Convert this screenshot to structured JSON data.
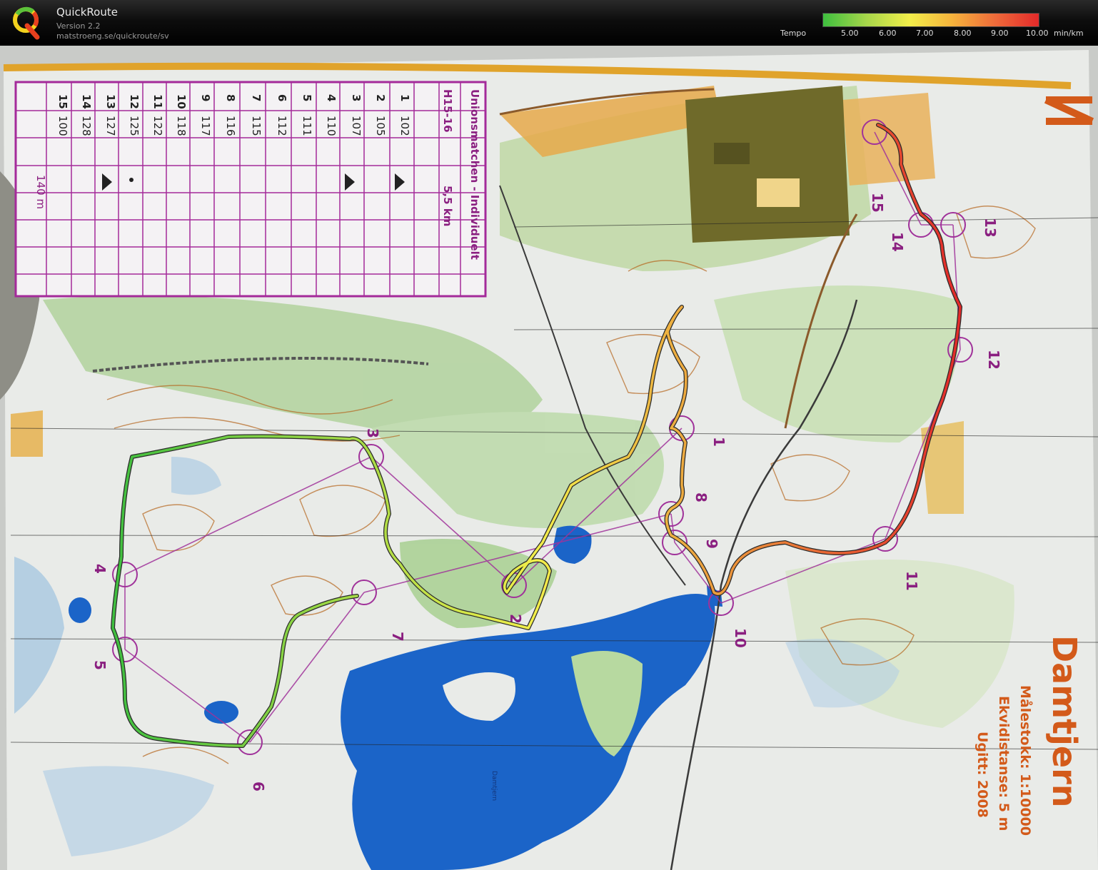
{
  "header": {
    "title": "QuickRoute",
    "version": "Version 2.2",
    "url": "matstroeng.se/quickroute/sv"
  },
  "legend": {
    "label": "Tempo",
    "unit": "min/km",
    "ticks": [
      "5.00",
      "6.00",
      "7.00",
      "8.00",
      "9.00",
      "10.00"
    ],
    "colors": [
      "#3fbf3f",
      "#a6d64a",
      "#f2ee4a",
      "#f5b23c",
      "#ee6a3a",
      "#e32a2a"
    ]
  },
  "control_card": {
    "event": "Unionsmatchen - Individuelt",
    "class": "H15-16",
    "length": "5,5 km",
    "rows": [
      {
        "n": "1",
        "code": "102"
      },
      {
        "n": "2",
        "code": "105"
      },
      {
        "n": "3",
        "code": "107"
      },
      {
        "n": "4",
        "code": "110"
      },
      {
        "n": "5",
        "code": "111"
      },
      {
        "n": "6",
        "code": "112"
      },
      {
        "n": "7",
        "code": "115"
      },
      {
        "n": "8",
        "code": "116"
      },
      {
        "n": "9",
        "code": "117"
      },
      {
        "n": "10",
        "code": "118"
      },
      {
        "n": "11",
        "code": "122"
      },
      {
        "n": "12",
        "code": "125"
      },
      {
        "n": "13",
        "code": "127"
      },
      {
        "n": "14",
        "code": "128"
      },
      {
        "n": "15",
        "code": "100"
      }
    ],
    "finish": "140 m"
  },
  "map": {
    "name": "Damtjern",
    "scale": "Målestokk: 1:10000",
    "contour": "Ekvidistanse: 5 m",
    "published": "Ugitt: 2008",
    "lake_label": "Damtjern",
    "controls": [
      "1",
      "2",
      "3",
      "4",
      "5",
      "6",
      "7",
      "8",
      "9",
      "10",
      "11",
      "12",
      "13",
      "14",
      "15"
    ]
  }
}
